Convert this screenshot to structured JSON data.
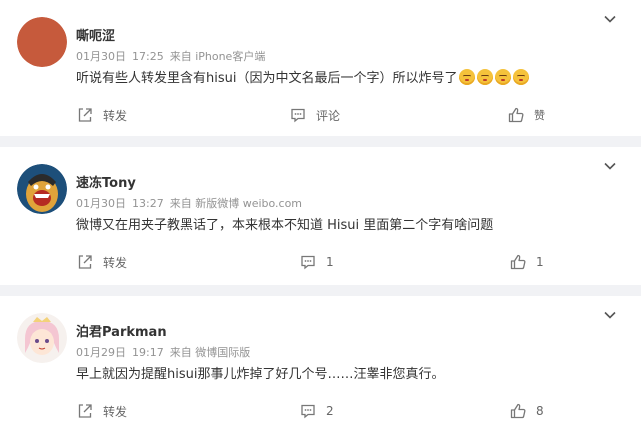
{
  "comments": [
    {
      "username": "嘶呃涩",
      "date": "01月30日",
      "time": "17:25",
      "source": "来自 iPhone客户端",
      "text": "听说有些人转发里含有hisui（因为中文名最后一个字）所以炸号了",
      "emoji_count": 4,
      "repost_label": "转发",
      "comment_label": "评论",
      "like_label": "赞",
      "comment_count": "",
      "like_count": ""
    },
    {
      "username": "速冻Tony",
      "date": "01月30日",
      "time": "13:27",
      "source": "来自 新版微博 weibo.com",
      "text": "微博又在用夹子教黑话了，本来根本不知道 Hisui 里面第二个字有啥问题",
      "repost_label": "转发",
      "comment_count": "1",
      "like_count": "1"
    },
    {
      "username": "泊君Parkman",
      "date": "01月29日",
      "time": "19:17",
      "source": "来自 微博国际版",
      "text": "早上就因为提醒hisui那事儿炸掉了好几个号……汪睾非您真行。",
      "repost_label": "转发",
      "comment_count": "2",
      "like_count": "8"
    }
  ],
  "icons": {
    "menu": "chevron-down-icon",
    "repost": "repost-icon",
    "comment": "comment-icon",
    "like": "thumbs-up-icon",
    "emoji": "sleepy-face-emoji"
  },
  "colors": {
    "background": "#f1f2f5",
    "meta_text": "#939393",
    "action_text": "#666666"
  }
}
